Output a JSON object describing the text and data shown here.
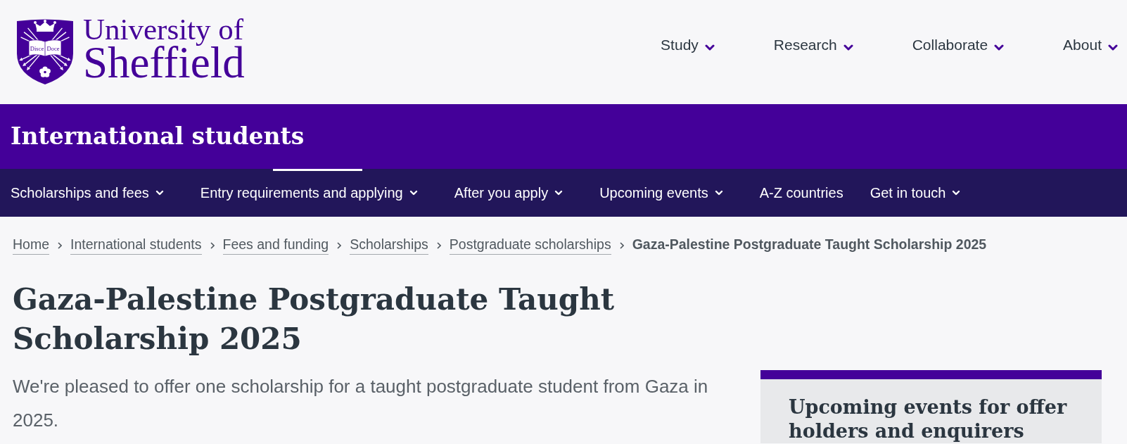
{
  "header": {
    "logo": {
      "motto": [
        "Disce",
        "Doce"
      ],
      "wordmark": [
        "University of",
        "Sheffield"
      ]
    },
    "nav": [
      {
        "label": "Study",
        "has_menu": true
      },
      {
        "label": "Research",
        "has_menu": true
      },
      {
        "label": "Collaborate",
        "has_menu": true
      },
      {
        "label": "About",
        "has_menu": true
      }
    ]
  },
  "section_banner": {
    "title": "International students"
  },
  "section_nav": [
    {
      "label": "Scholarships and fees",
      "has_menu": true,
      "selected": false
    },
    {
      "label": "Entry requirements and applying",
      "has_menu": true,
      "selected": true
    },
    {
      "label": "After you apply",
      "has_menu": true,
      "selected": false
    },
    {
      "label": "Upcoming events",
      "has_menu": true,
      "selected": false
    },
    {
      "label": "A-Z countries",
      "has_menu": false,
      "selected": false
    },
    {
      "label": "Get in touch",
      "has_menu": true,
      "selected": false
    }
  ],
  "breadcrumbs": [
    {
      "label": "Home",
      "current": false
    },
    {
      "label": "International students",
      "current": false
    },
    {
      "label": "Fees and funding",
      "current": false
    },
    {
      "label": "Scholarships",
      "current": false
    },
    {
      "label": "Postgraduate scholarships",
      "current": false
    },
    {
      "label": "Gaza-Palestine Postgraduate Taught Scholarship 2025",
      "current": true
    }
  ],
  "page": {
    "title": "Gaza-Palestine Postgraduate Taught Scholarship 2025",
    "intro": "We're pleased to offer one scholarship for a taught postgraduate student from Gaza in 2025."
  },
  "sidebar": {
    "title": "Upcoming events for offer holders and enquirers"
  }
}
